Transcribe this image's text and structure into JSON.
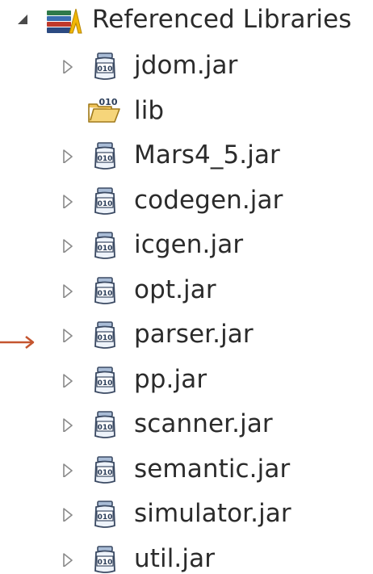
{
  "root": {
    "label": "Referenced Libraries",
    "toggle_icon": "expanded-triangle-icon",
    "icon": "libraries-stack-icon"
  },
  "items": [
    {
      "label": "jdom.jar",
      "icon": "jar-icon",
      "expandable": true
    },
    {
      "label": "lib",
      "icon": "binary-folder-icon",
      "expandable": false
    },
    {
      "label": "Mars4_5.jar",
      "icon": "jar-icon",
      "expandable": true
    },
    {
      "label": "codegen.jar",
      "icon": "jar-icon",
      "expandable": true
    },
    {
      "label": "icgen.jar",
      "icon": "jar-icon",
      "expandable": true
    },
    {
      "label": "opt.jar",
      "icon": "jar-icon",
      "expandable": true
    },
    {
      "label": "parser.jar",
      "icon": "jar-icon",
      "expandable": true
    },
    {
      "label": "pp.jar",
      "icon": "jar-icon",
      "expandable": true
    },
    {
      "label": "scanner.jar",
      "icon": "jar-icon",
      "expandable": true
    },
    {
      "label": "semantic.jar",
      "icon": "jar-icon",
      "expandable": true
    },
    {
      "label": "simulator.jar",
      "icon": "jar-icon",
      "expandable": true
    },
    {
      "label": "util.jar",
      "icon": "jar-icon",
      "expandable": true
    }
  ],
  "jar_icon_text": "010",
  "annotation": {
    "icon": "pointer-arrow-icon",
    "color": "#c4552f"
  },
  "colors": {
    "text": "#2b2b2b",
    "toggle": "#8a8a8a",
    "jar_outline": "#3b4a63",
    "jar_cap": "#7d95b8",
    "folder": "#f0c45a"
  }
}
